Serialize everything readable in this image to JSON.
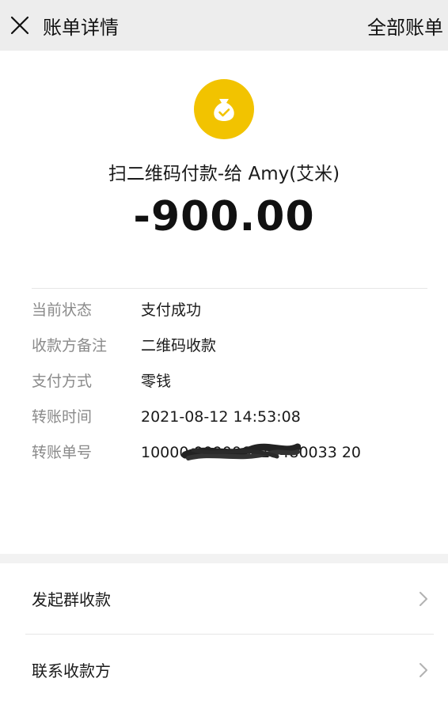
{
  "header": {
    "title": "账单详情",
    "all_bills": "全部账单"
  },
  "transaction": {
    "icon": "money-bag-check-icon",
    "icon_color": "#f2c300",
    "description": "扫二维码付款-给 Amy(艾米)",
    "amount": "-900.00"
  },
  "details": [
    {
      "label": "当前状态",
      "value": "支付成功"
    },
    {
      "label": "收款方备注",
      "value": "二维码收款"
    },
    {
      "label": "支付方式",
      "value": "零钱"
    },
    {
      "label": "转账时间",
      "value": "2021-08-12 14:53:08"
    },
    {
      "label": "转账单号",
      "value": "10000 009006415480033 20"
    }
  ],
  "menu": [
    {
      "label": "发起群收款",
      "icon": "chevron-right-icon"
    },
    {
      "label": "联系收款方",
      "icon": "chevron-right-icon"
    }
  ]
}
